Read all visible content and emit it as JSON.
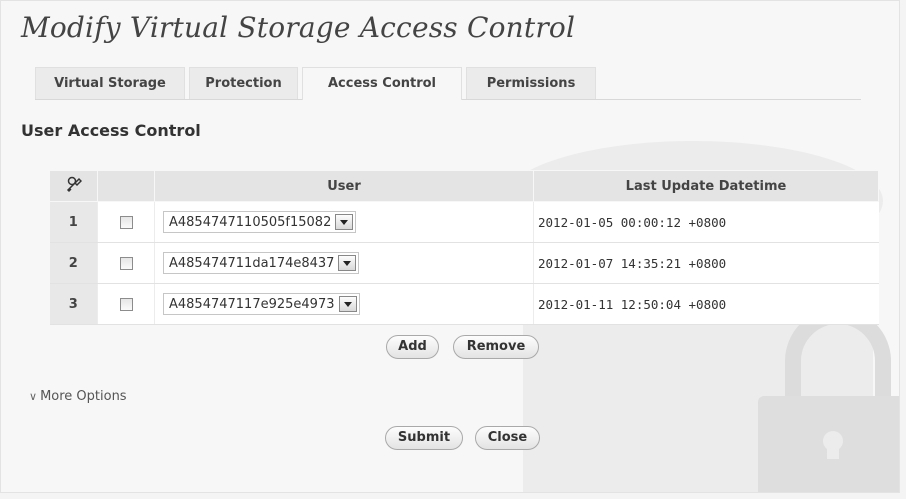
{
  "title": "Modify Virtual Storage Access Control",
  "tabs": [
    {
      "label": "Virtual Storage",
      "active": false
    },
    {
      "label": "Protection",
      "active": false
    },
    {
      "label": "Access Control",
      "active": true
    },
    {
      "label": "Permissions",
      "active": false
    }
  ],
  "section_title": "User Access Control",
  "table": {
    "header_icon": "key-icon",
    "columns": [
      "User",
      "Last Update Datetime"
    ],
    "rows": [
      {
        "num": "1",
        "checked": false,
        "user": "A4854747110505f15082",
        "datetime": "2012-01-05 00:00:12 +0800"
      },
      {
        "num": "2",
        "checked": false,
        "user": "A485474711da174e8437",
        "datetime": "2012-01-07 14:35:21 +0800"
      },
      {
        "num": "3",
        "checked": false,
        "user": "A4854747117e925e4973",
        "datetime": "2012-01-11 12:50:04 +0800"
      }
    ]
  },
  "buttons": {
    "add": "Add",
    "remove": "Remove",
    "submit": "Submit",
    "close": "Close"
  },
  "more_options": {
    "label": "More Options",
    "icon": "chevron-down-icon"
  },
  "colors": {
    "background": "#f7f7f7",
    "header": "#e4e4e4",
    "watermark": "#e9e9e9"
  }
}
